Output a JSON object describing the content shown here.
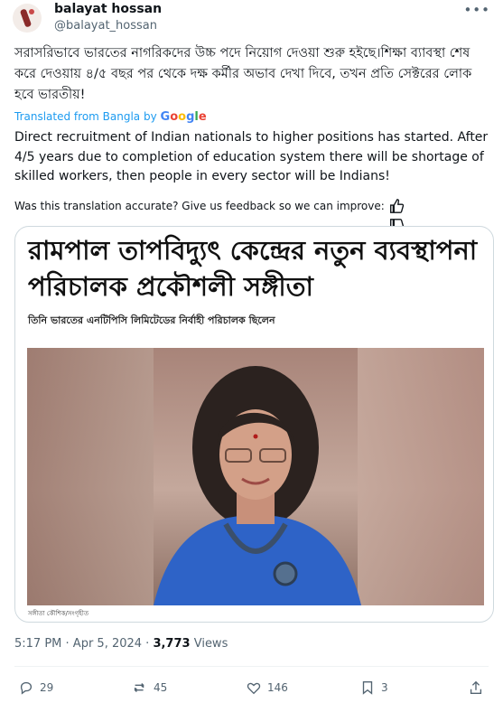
{
  "user": {
    "name": "balayat hossan",
    "handle": "@balayat_hossan"
  },
  "post": {
    "original_text": "সরাসরিভাবে ভারতের নাগরিকদের উচ্চ পদে নিয়োগ দেওয়া শুরু হইছে।শিক্ষা ব্যাবস্থা শেষ করে দেওয়ায় ৪/৫ বছর পর থেকে দক্ষ কর্মীর অভাব দেখা দিবে, তখন প্রতি সেক্টরের লোক হবে ভারতীয়!",
    "translated_label": "Translated from Bangla by",
    "google": "Google",
    "translation": "Direct recruitment of Indian nationals to higher positions has started. After 4/5 years due to completion of education system there will be shortage of skilled workers, then people in every sector will be Indians!",
    "feedback_prompt": "Was this translation accurate? Give us feedback so we can improve:"
  },
  "media": {
    "headline": "রামপাল তাপবিদ্যুৎ কেন্দ্রের নতুন ব্যবস্থাপনা পরিচালক প্রকৌশলী সঙ্গীতা",
    "subheadline": "তিনি ভারতের এনটিপিসি লিমিটেডের নির্বাহী পরিচালক ছিলেন",
    "caption": "সঙ্গীতা কৌশিক/সংগৃহীত"
  },
  "meta": {
    "time": "5:17 PM",
    "date": "Apr 5, 2024",
    "views_count": "3,773",
    "views_label": "Views"
  },
  "actions": {
    "replies": "29",
    "reposts": "45",
    "likes": "146",
    "bookmarks": "3"
  },
  "colors": {
    "link": "#1d9bf0",
    "muted": "#536471",
    "border": "#cfd9de"
  }
}
